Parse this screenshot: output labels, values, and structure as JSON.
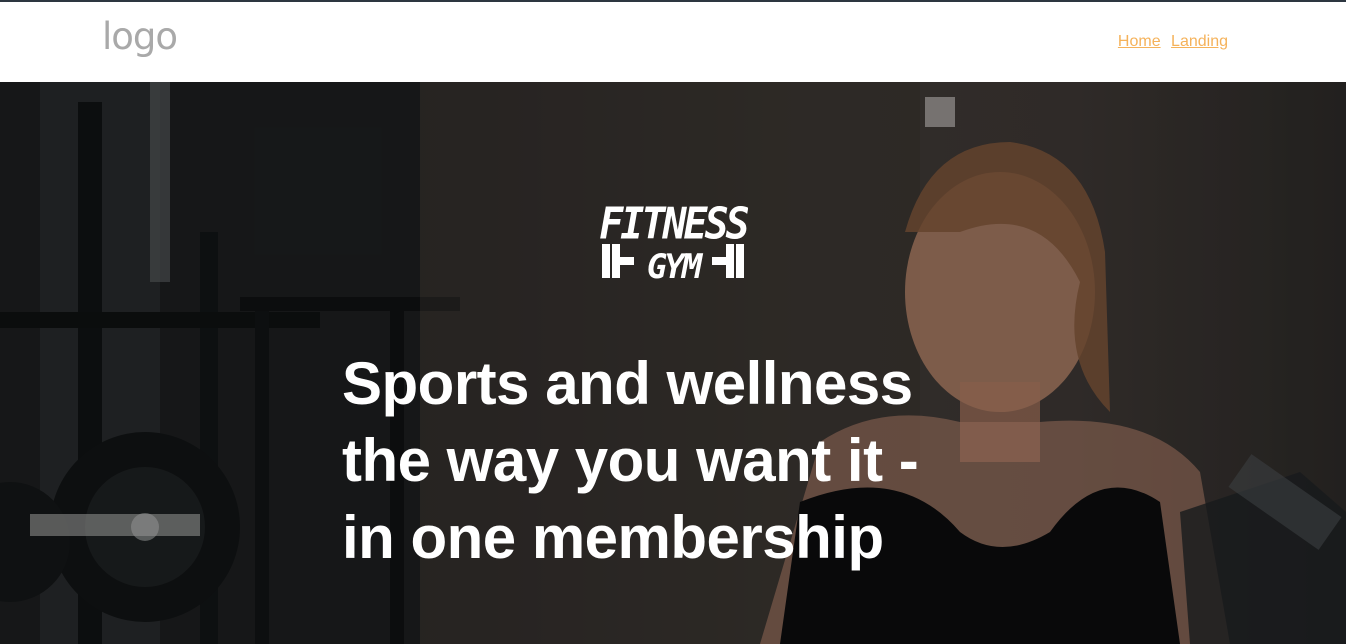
{
  "header": {
    "logo_text": "logo",
    "nav": [
      {
        "label": "Home"
      },
      {
        "label": "Landing"
      }
    ]
  },
  "hero": {
    "brand_logo_line1": "FITNESS",
    "brand_logo_line2": "GYM",
    "headline_lines": [
      "Sports and wellness",
      "the way you want it -",
      "in one membership"
    ]
  },
  "colors": {
    "nav_link": "#f5b25a",
    "logo_gray": "#a9a9a9",
    "hero_text": "#ffffff",
    "top_border": "#2d3640"
  }
}
